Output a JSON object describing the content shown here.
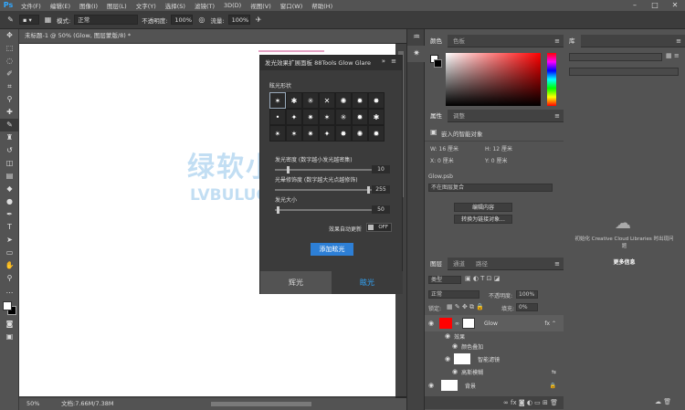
{
  "app": {
    "logo": "Ps"
  },
  "menu": [
    "文件(F)",
    "编辑(E)",
    "图像(I)",
    "图层(L)",
    "文字(Y)",
    "选择(S)",
    "滤镜(T)",
    "3D(D)",
    "视图(V)",
    "窗口(W)",
    "帮助(H)"
  ],
  "options": {
    "mode_label": "模式:",
    "mode_value": "正常",
    "opacity_label": "不透明度:",
    "opacity_value": "100%",
    "flow_label": "流量:",
    "flow_value": "100%"
  },
  "document": {
    "tab_title": "未标题-1 @ 50% (Glow, 图层蒙版/8) *",
    "zoom": "50%",
    "doc_size": "文档:7.66M/7.38M"
  },
  "glow_panel": {
    "title": "发光效果扩展面板 88Tools Glow Glare",
    "shape_label": "眩光形状",
    "grid": [
      "✶",
      "✱",
      "✳",
      "✕",
      "✺",
      "✹",
      "✸",
      "•",
      "✦",
      "✷",
      "✶",
      "✳",
      "✹",
      "✱",
      "✴",
      "✶",
      "✷",
      "✦",
      "✸",
      "✺",
      "✹"
    ],
    "s1_label": "发光密度 (数字越小发光越密集)",
    "s1_value": "10",
    "s1_fill": 0.12,
    "s2_label": "光晕修饰度 (数字越大光点越修饰)",
    "s2_value": "255",
    "s2_fill": 0.96,
    "s3_label": "发光大小",
    "s3_value": "50",
    "s3_fill": 0.02,
    "auto_label": "效果自动更新",
    "auto_state": "OFF",
    "add_button": "添加眩光",
    "tab_left": "辉光",
    "tab_right": "眩光"
  },
  "watermark": {
    "line1": "绿软小站",
    "line2": "LVBULUO.COM"
  },
  "color_panel": {
    "tabs": [
      "颜色",
      "色板"
    ]
  },
  "props_panel": {
    "tabs": [
      "属性",
      "调整"
    ],
    "type": "嵌入的智能对象",
    "w": "W: 16 厘米",
    "h": "H: 12 厘米",
    "x": "X: 0 厘米",
    "y": "Y: 0 厘米",
    "file": "Glow.psb",
    "comp": "不在图层复合",
    "btn_edit": "编辑内容",
    "btn_convert": "转换为链接对象..."
  },
  "layers_panel": {
    "tabs": [
      "图层",
      "通道",
      "路径"
    ],
    "kind": "类型",
    "blend": "正常",
    "opacity_label": "不透明度:",
    "opacity": "100%",
    "lock_label": "锁定:",
    "fill_label": "填充:",
    "fill": "0%",
    "layers": [
      {
        "name": "Glow"
      },
      {
        "name": "效果"
      },
      {
        "name": "颜色叠加"
      },
      {
        "name": "智能滤镜"
      },
      {
        "name": "高斯模糊"
      },
      {
        "name": "背景"
      }
    ]
  },
  "libraries_panel": {
    "tab": "库",
    "msg": "初始化 Creative Cloud Libraries 时出现问题",
    "more": "更多信息"
  },
  "colors": {
    "accent": "#31a8ff",
    "button": "#2d7fd6",
    "layer_red": "#ff0000"
  }
}
